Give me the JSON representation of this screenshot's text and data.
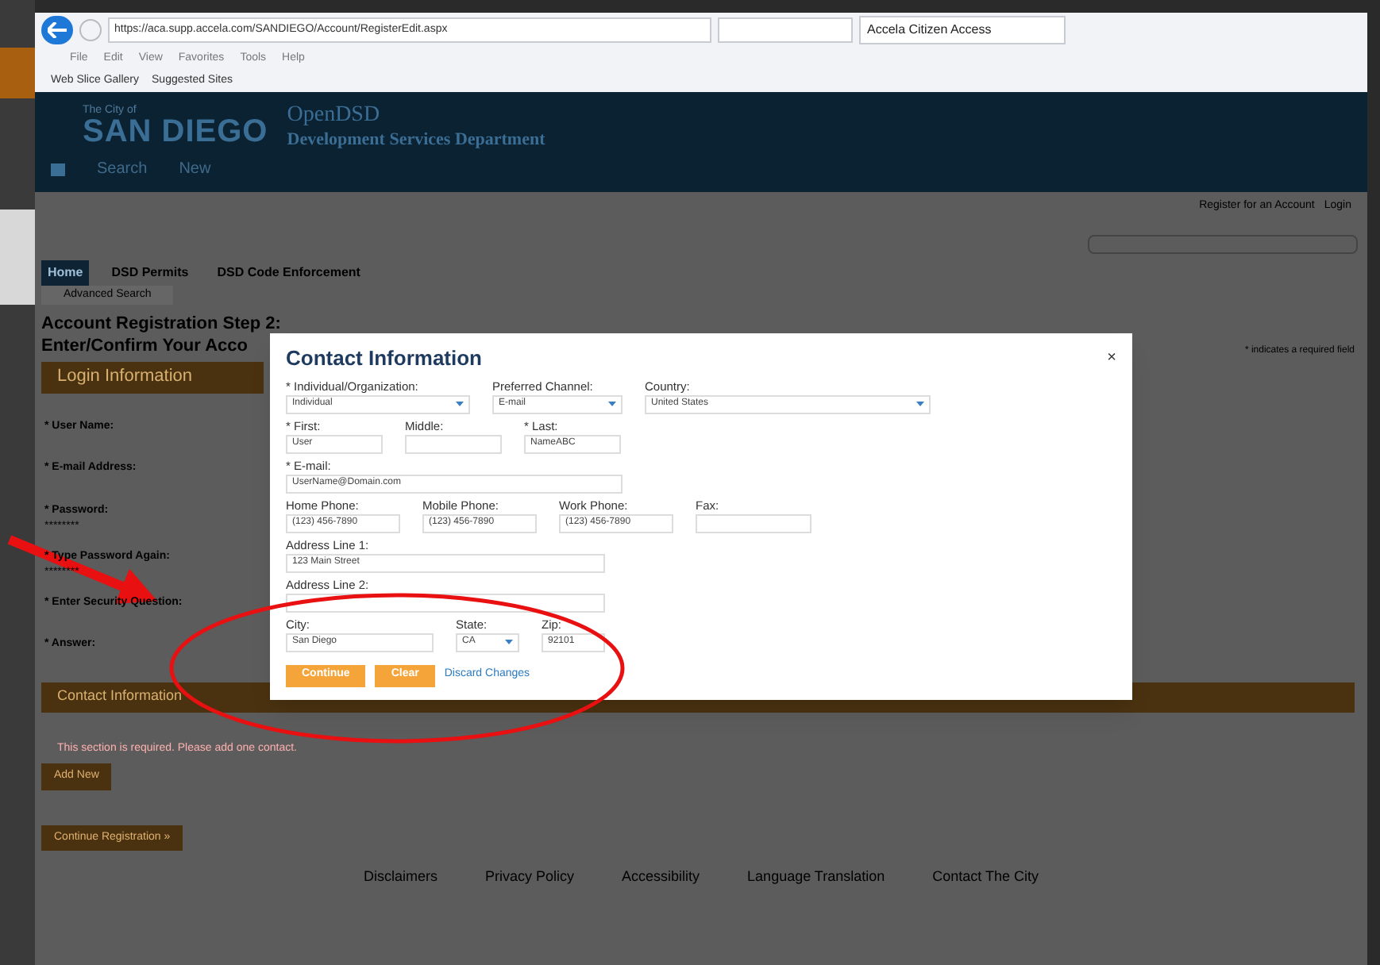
{
  "browser": {
    "url": "https://aca.supp.accela.com/SANDIEGO/Account/RegisterEdit.aspx",
    "tab_title": "Accela Citizen Access",
    "menu": [
      "File",
      "Edit",
      "View",
      "Favorites",
      "Tools",
      "Help"
    ],
    "favorites": [
      "Web Slice Gallery",
      "Suggested Sites"
    ]
  },
  "header": {
    "city_line": "The City of",
    "city": "SAN DIEGO",
    "app": "OpenDSD",
    "department": "Development Services Department",
    "nav": [
      "Search",
      "New"
    ]
  },
  "page": {
    "top_links": [
      "Register for an Account",
      "Login"
    ],
    "tabs": [
      {
        "label": "Home",
        "selected": true
      },
      {
        "label": "DSD Permits",
        "selected": false
      },
      {
        "label": "DSD Code Enforcement",
        "selected": false
      }
    ],
    "subtab": "Advanced Search",
    "heading": [
      "Account Registration Step 2:",
      "Enter/Confirm Your Acco"
    ],
    "required_note": "* indicates a required field",
    "login_section": {
      "title": "Login Information",
      "fields": [
        {
          "label": "* User Name:"
        },
        {
          "label": "* E-mail Address:"
        },
        {
          "label": "* Password:",
          "value": "********"
        },
        {
          "label": "* Type Password Again:",
          "value": "********"
        },
        {
          "label": "* Enter Security Question:"
        },
        {
          "label": "* Answer:"
        }
      ]
    },
    "contact_section": {
      "title": "Contact Information",
      "error": "This section is required. Please add one contact.",
      "add_button": "Add New"
    },
    "continue_button": "Continue Registration »",
    "footer": [
      "Disclaimers",
      "Privacy Policy",
      "Accessibility",
      "Language Translation",
      "Contact The City"
    ]
  },
  "modal": {
    "title": "Contact Information",
    "close": "×",
    "field_rows": [
      {
        "fields": [
          {
            "kind": "select",
            "label": "* Individual/Organization:",
            "value": "Individual"
          },
          {
            "kind": "select",
            "label": "Preferred Channel:",
            "value": "E-mail"
          },
          {
            "kind": "select",
            "label": "Country:",
            "value": "United States"
          }
        ]
      },
      {
        "fields": [
          {
            "kind": "text",
            "label": "* First:",
            "value": "User"
          },
          {
            "kind": "text",
            "label": "Middle:"
          },
          {
            "kind": "text",
            "label": "* Last:",
            "value": "NameABC"
          }
        ]
      },
      {
        "fields": [
          {
            "kind": "text",
            "label": "* E-mail:",
            "value": "UserName@Domain.com"
          }
        ]
      },
      {
        "fields": [
          {
            "kind": "text",
            "label": "Home Phone:",
            "value": "(123) 456-7890"
          },
          {
            "kind": "text",
            "label": "Mobile Phone:",
            "value": "(123) 456-7890"
          },
          {
            "kind": "text",
            "label": "Work Phone:",
            "value": "(123) 456-7890"
          },
          {
            "kind": "text",
            "label": "Fax:"
          }
        ]
      },
      {
        "fields": [
          {
            "kind": "text",
            "label": "Address Line 1:",
            "value": "123 Main Street"
          }
        ]
      },
      {
        "fields": [
          {
            "kind": "text",
            "label": "Address Line 2:"
          }
        ]
      },
      {
        "fields": [
          {
            "kind": "text",
            "label": "City:",
            "value": "San Diego"
          },
          {
            "kind": "select",
            "label": "State:",
            "value": "CA"
          },
          {
            "kind": "text",
            "label": "Zip:",
            "value": "92101"
          }
        ]
      }
    ],
    "buttons": [
      {
        "kind": "primary",
        "label": "Continue"
      },
      {
        "kind": "primary",
        "label": "Clear"
      },
      {
        "kind": "link",
        "label": "Discard Changes"
      }
    ]
  }
}
